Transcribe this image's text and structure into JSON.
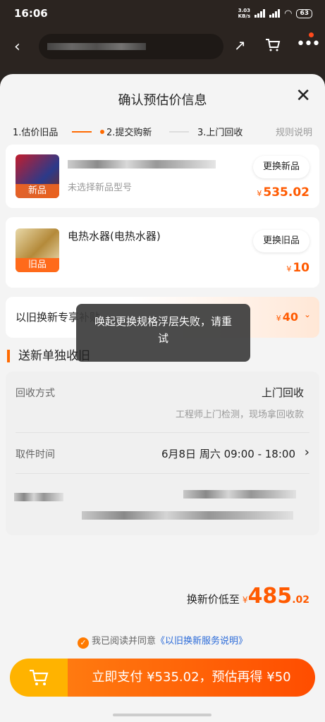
{
  "status_bar": {
    "time": "16:06",
    "net_speed": "3.03",
    "net_unit": "KB/s",
    "battery": "63"
  },
  "nav": {
    "back_icon": "back-arrow-icon",
    "share_icon": "share-icon",
    "cart_icon": "cart-icon",
    "more_icon": "more-icon",
    "accent": "#ff6a00"
  },
  "sheet": {
    "title": "确认预估价信息",
    "steps": [
      "1.估价旧品",
      "2.提交购新",
      "3.上门回收"
    ],
    "rules_link": "规则说明"
  },
  "new_item": {
    "tag": "新品",
    "subtitle": "未选择新品型号",
    "change_button": "更换新品",
    "currency": "¥",
    "price": "535.02"
  },
  "old_item": {
    "tag": "旧品",
    "title": "电热水器(电热水器)",
    "change_button": "更换旧品",
    "currency": "¥",
    "price": "10"
  },
  "subsidy": {
    "label": "以旧换新专享补贴",
    "currency": "¥",
    "amount": "40"
  },
  "toast": {
    "message": "唤起更换规格浮层失败，请重试"
  },
  "section": {
    "title": "送新单独收旧"
  },
  "recycle": {
    "method_label": "回收方式",
    "method_value": "上门回收",
    "method_desc": "工程师上门检测，现场拿回收款",
    "pickup_label": "取件时间",
    "pickup_value": "6月8日 周六 09:00 - 18:00"
  },
  "summary": {
    "label": "换新价低至",
    "currency": "¥",
    "int": "485",
    "dec": ".02"
  },
  "agreement": {
    "prefix": "我已阅读并同意",
    "link": "《以旧换新服务说明》"
  },
  "pay_button": {
    "label": "立即支付 ¥535.02，预估再得 ¥50"
  }
}
